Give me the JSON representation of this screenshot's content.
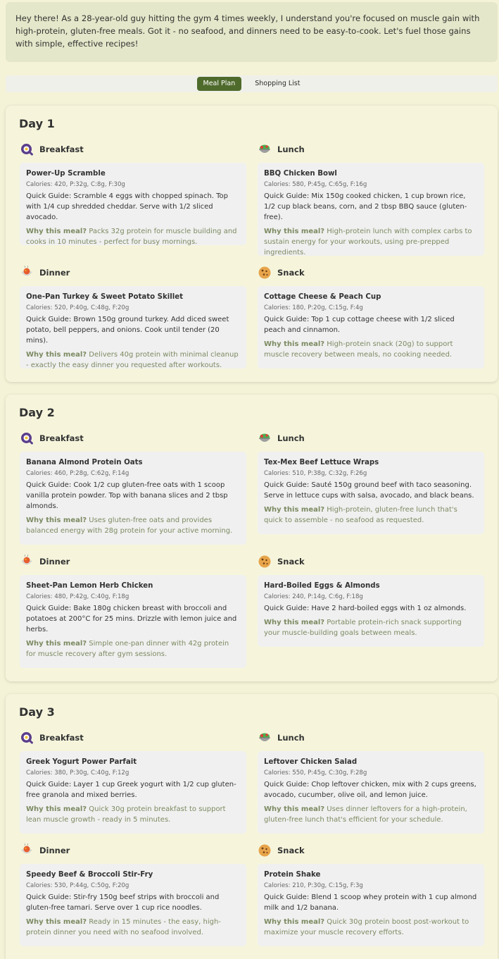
{
  "intro_text": "Hey there! As a 28-year-old guy hitting the gym 4 times weekly, I understand you're focused on muscle gain with high-protein, gluten-free meals. Got it - no seafood, and dinners need to be easy-to-cook. Let's fuel those gains with simple, effective recipes!",
  "tabs": [
    {
      "label": "Meal Plan",
      "active": true
    },
    {
      "label": "Shopping List",
      "active": false
    }
  ],
  "why_label": "Why this meal?",
  "days": [
    {
      "title": "Day 1",
      "meals": [
        {
          "type": "Breakfast",
          "icon": "breakfast-icon",
          "name": "Power-Up Scramble",
          "macros": "Calories: 420, P:32g, C:8g, F:30g",
          "guide": "Quick Guide: Scramble 4 eggs with chopped spinach. Top with 1/4 cup shredded cheddar. Serve with 1/2 sliced avocado.",
          "why": "Packs 32g protein for muscle building and cooks in 10 minutes - perfect for busy mornings."
        },
        {
          "type": "Lunch",
          "icon": "lunch-icon",
          "name": "BBQ Chicken Bowl",
          "macros": "Calories: 580, P:45g, C:65g, F:16g",
          "guide": "Quick Guide: Mix 150g cooked chicken, 1 cup brown rice, 1/2 cup black beans, corn, and 2 tbsp BBQ sauce (gluten-free).",
          "why": "High-protein lunch with complex carbs to sustain energy for your workouts, using pre-prepped ingredients."
        },
        {
          "type": "Dinner",
          "icon": "dinner-icon",
          "name": "One-Pan Turkey & Sweet Potato Skillet",
          "macros": "Calories: 520, P:40g, C:48g, F:20g",
          "guide": "Quick Guide: Brown 150g ground turkey. Add diced sweet potato, bell peppers, and onions. Cook until tender (20 mins).",
          "why": "Delivers 40g protein with minimal cleanup - exactly the easy dinner you requested after workouts."
        },
        {
          "type": "Snack",
          "icon": "snack-icon",
          "name": "Cottage Cheese & Peach Cup",
          "macros": "Calories: 180, P:20g, C:15g, F:4g",
          "guide": "Quick Guide: Top 1 cup cottage cheese with 1/2 sliced peach and cinnamon.",
          "why": "High-protein snack (20g) to support muscle recovery between meals, no cooking needed."
        }
      ]
    },
    {
      "title": "Day 2",
      "meals": [
        {
          "type": "Breakfast",
          "icon": "breakfast-icon",
          "name": "Banana Almond Protein Oats",
          "macros": "Calories: 460, P:28g, C:62g, F:14g",
          "guide": "Quick Guide: Cook 1/2 cup gluten-free oats with 1 scoop vanilla protein powder. Top with banana slices and 2 tbsp almonds.",
          "why": "Uses gluten-free oats and provides balanced energy with 28g protein for your active morning."
        },
        {
          "type": "Lunch",
          "icon": "lunch-icon",
          "name": "Tex-Mex Beef Lettuce Wraps",
          "macros": "Calories: 510, P:38g, C:32g, F:26g",
          "guide": "Quick Guide: Sauté 150g ground beef with taco seasoning. Serve in lettuce cups with salsa, avocado, and black beans.",
          "why": "High-protein, gluten-free lunch that's quick to assemble - no seafood as requested."
        },
        {
          "type": "Dinner",
          "icon": "dinner-icon",
          "name": "Sheet-Pan Lemon Herb Chicken",
          "macros": "Calories: 480, P:42g, C:40g, F:18g",
          "guide": "Quick Guide: Bake 180g chicken breast with broccoli and potatoes at 200°C for 25 mins. Drizzle with lemon juice and herbs.",
          "why": "Simple one-pan dinner with 42g protein for muscle recovery after gym sessions."
        },
        {
          "type": "Snack",
          "icon": "snack-icon",
          "name": "Hard-Boiled Eggs & Almonds",
          "macros": "Calories: 240, P:14g, C:6g, F:18g",
          "guide": "Quick Guide: Have 2 hard-boiled eggs with 1 oz almonds.",
          "why": "Portable protein-rich snack supporting your muscle-building goals between meals."
        }
      ]
    },
    {
      "title": "Day 3",
      "meals": [
        {
          "type": "Breakfast",
          "icon": "breakfast-icon",
          "name": "Greek Yogurt Power Parfait",
          "macros": "Calories: 380, P:30g, C:40g, F:12g",
          "guide": "Quick Guide: Layer 1 cup Greek yogurt with 1/2 cup gluten-free granola and mixed berries.",
          "why": "Quick 30g protein breakfast to support lean muscle growth - ready in 5 minutes."
        },
        {
          "type": "Lunch",
          "icon": "lunch-icon",
          "name": "Leftover Chicken Salad",
          "macros": "Calories: 550, P:45g, C:30g, F:28g",
          "guide": "Quick Guide: Chop leftover chicken, mix with 2 cups greens, avocado, cucumber, olive oil, and lemon juice.",
          "why": "Uses dinner leftovers for a high-protein, gluten-free lunch that's efficient for your schedule."
        },
        {
          "type": "Dinner",
          "icon": "dinner-icon",
          "name": "Speedy Beef & Broccoli Stir-Fry",
          "macros": "Calories: 530, P:44g, C:50g, F:20g",
          "guide": "Quick Guide: Stir-fry 150g beef strips with broccoli and gluten-free tamari. Serve over 1 cup rice noodles.",
          "why": "Ready in 15 minutes - the easy, high-protein dinner you need with no seafood involved."
        },
        {
          "type": "Snack",
          "icon": "snack-icon",
          "name": "Protein Shake",
          "macros": "Calories: 210, P:30g, C:15g, F:3g",
          "guide": "Quick Guide: Blend 1 scoop whey protein with 1 cup almond milk and 1/2 banana.",
          "why": "Quick 30g protein boost post-workout to maximize your muscle recovery efforts."
        }
      ]
    }
  ]
}
